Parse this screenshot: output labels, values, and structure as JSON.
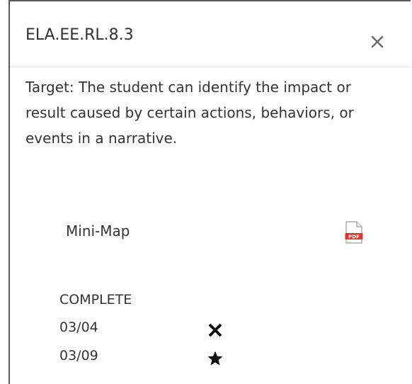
{
  "popup": {
    "title": "ELA.EE.RL.8.3",
    "close_icon": "close-icon",
    "target_text": "Target: The student can identify the impact or result caused by certain actions, behaviors, or events in a narrative.",
    "minimap": {
      "label": "Mini-Map",
      "icon": "pdf-icon"
    },
    "status": {
      "label": "COMPLETE",
      "entries": [
        {
          "date": "03/04",
          "icon": "x-mark-icon"
        },
        {
          "date": "03/09",
          "icon": "star-icon"
        }
      ]
    }
  },
  "colors": {
    "text": "#333333",
    "pdf_red": "#d9372b",
    "divider": "#e5e5e5"
  }
}
